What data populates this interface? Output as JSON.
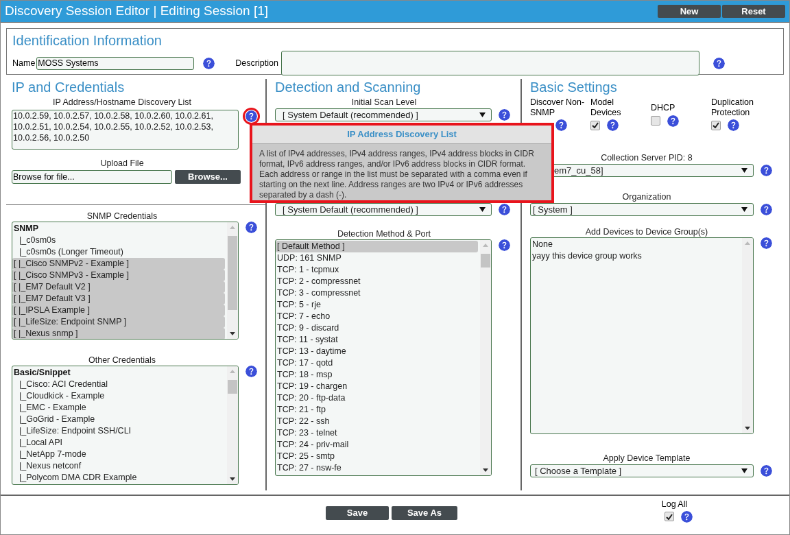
{
  "window": {
    "title": "Discovery Session Editor | Editing Session [1]",
    "buttons": [
      "New",
      "Reset"
    ]
  },
  "identification": {
    "heading": "Identification Information",
    "name_label": "Name",
    "name_value": "MOSS Systems",
    "description_label": "Description"
  },
  "ip_credentials": {
    "heading": "IP and Credentials",
    "ip_list_label": "IP Address/Hostname Discovery List",
    "ip_list_value": "10.0.2.59, 10.0.2.57, 10.0.2.58, 10.0.2.60, 10.0.2.61, 10.0.2.51, 10.0.2.54, 10.0.2.55, 10.0.2.52, 10.0.2.53, 10.0.2.56, 10.0.2.50",
    "upload_label": "Upload File",
    "upload_value": "Browse for file...",
    "browse_button": "Browse...",
    "snmp_label": "SNMP Credentials",
    "snmp_items": [
      {
        "text": "SNMP",
        "kind": "group",
        "selected": false
      },
      {
        "text": "|_c0sm0s",
        "kind": "item",
        "selected": false
      },
      {
        "text": "|_c0sm0s (Longer Timeout)",
        "kind": "item",
        "selected": false
      },
      {
        "text": "[ |_Cisco SNMPv2 - Example ]",
        "kind": "item",
        "selected": true
      },
      {
        "text": "[ |_Cisco SNMPv3 - Example ]",
        "kind": "item",
        "selected": true
      },
      {
        "text": "[ |_EM7 Default V2 ]",
        "kind": "item",
        "selected": true
      },
      {
        "text": "[ |_EM7 Default V3 ]",
        "kind": "item",
        "selected": true
      },
      {
        "text": "[ |_IPSLA Example ]",
        "kind": "item",
        "selected": true
      },
      {
        "text": "[ |_LifeSize: Endpoint SNMP ]",
        "kind": "item",
        "selected": true
      },
      {
        "text": "[ |_Nexus snmp ]",
        "kind": "item",
        "selected": true
      }
    ],
    "other_label": "Other Credentials",
    "other_items": [
      {
        "text": "Basic/Snippet",
        "kind": "group",
        "selected": false
      },
      {
        "text": "|_Cisco: ACI Credential",
        "kind": "item",
        "selected": false
      },
      {
        "text": "|_Cloudkick - Example",
        "kind": "item",
        "selected": false
      },
      {
        "text": "|_EMC - Example",
        "kind": "item",
        "selected": false
      },
      {
        "text": "|_GoGrid - Example",
        "kind": "item",
        "selected": false
      },
      {
        "text": "|_LifeSize: Endpoint SSH/CLI",
        "kind": "item",
        "selected": false
      },
      {
        "text": "|_Local API",
        "kind": "item",
        "selected": false
      },
      {
        "text": "|_NetApp 7-mode",
        "kind": "item",
        "selected": false
      },
      {
        "text": "|_Nexus netconf",
        "kind": "item",
        "selected": false
      },
      {
        "text": "|_Polycom DMA CDR Example",
        "kind": "item",
        "selected": false
      }
    ]
  },
  "detection": {
    "heading": "Detection and Scanning",
    "initial_scan_label": "Initial Scan Level",
    "initial_scan_value": "[ System Default (recommended) ]",
    "lower_select_value": "[ System Default (recommended) ]",
    "method_label": "Detection Method & Port",
    "method_items": [
      {
        "text": "[ Default Method ]",
        "selected": true
      },
      {
        "text": "UDP: 161 SNMP",
        "selected": false
      },
      {
        "text": "TCP: 1 - tcpmux",
        "selected": false
      },
      {
        "text": "TCP: 2 - compressnet",
        "selected": false
      },
      {
        "text": "TCP: 3 - compressnet",
        "selected": false
      },
      {
        "text": "TCP: 5 - rje",
        "selected": false
      },
      {
        "text": "TCP: 7 - echo",
        "selected": false
      },
      {
        "text": "TCP: 9 - discard",
        "selected": false
      },
      {
        "text": "TCP: 11 - systat",
        "selected": false
      },
      {
        "text": "TCP: 13 - daytime",
        "selected": false
      },
      {
        "text": "TCP: 17 - qotd",
        "selected": false
      },
      {
        "text": "TCP: 18 - msp",
        "selected": false
      },
      {
        "text": "TCP: 19 - chargen",
        "selected": false
      },
      {
        "text": "TCP: 20 - ftp-data",
        "selected": false
      },
      {
        "text": "TCP: 21 - ftp",
        "selected": false
      },
      {
        "text": "TCP: 22 - ssh",
        "selected": false
      },
      {
        "text": "TCP: 23 - telnet",
        "selected": false
      },
      {
        "text": "TCP: 24 - priv-mail",
        "selected": false
      },
      {
        "text": "TCP: 25 - smtp",
        "selected": false
      },
      {
        "text": "TCP: 27 - nsw-fe",
        "selected": false
      }
    ]
  },
  "basic": {
    "heading": "Basic Settings",
    "options": [
      {
        "label": "Discover Non-SNMP"
      },
      {
        "label": "Model Devices",
        "checked": true
      },
      {
        "label": "DHCP",
        "checked": false
      },
      {
        "label": "Duplication Protection",
        "checked": true
      }
    ],
    "collection_label": "Collection Server PID: 8",
    "collection_value": "em7_cu_58]",
    "organization_label": "Organization",
    "organization_value": "[ System ]",
    "groups_label": "Add Devices to Device Group(s)",
    "groups_items": [
      "None",
      "yayy this device group works"
    ],
    "template_label": "Apply Device Template",
    "template_value": "[ Choose a Template ]"
  },
  "tooltip": {
    "title": "IP Address Discovery List",
    "text": "A list of IPv4 addresses, IPv4 address ranges, IPv4 address blocks in CIDR format, IPv6 address ranges, and/or IPv6 address blocks in CIDR format. Each address or range in the list must be separated with a comma even if starting on the next line. Address ranges are two IPv4 or IPv6 addresses separated by a dash (-)."
  },
  "footer": {
    "buttons": [
      "Save",
      "Save As"
    ],
    "log_all_label": "Log All",
    "log_all_checked": true
  }
}
